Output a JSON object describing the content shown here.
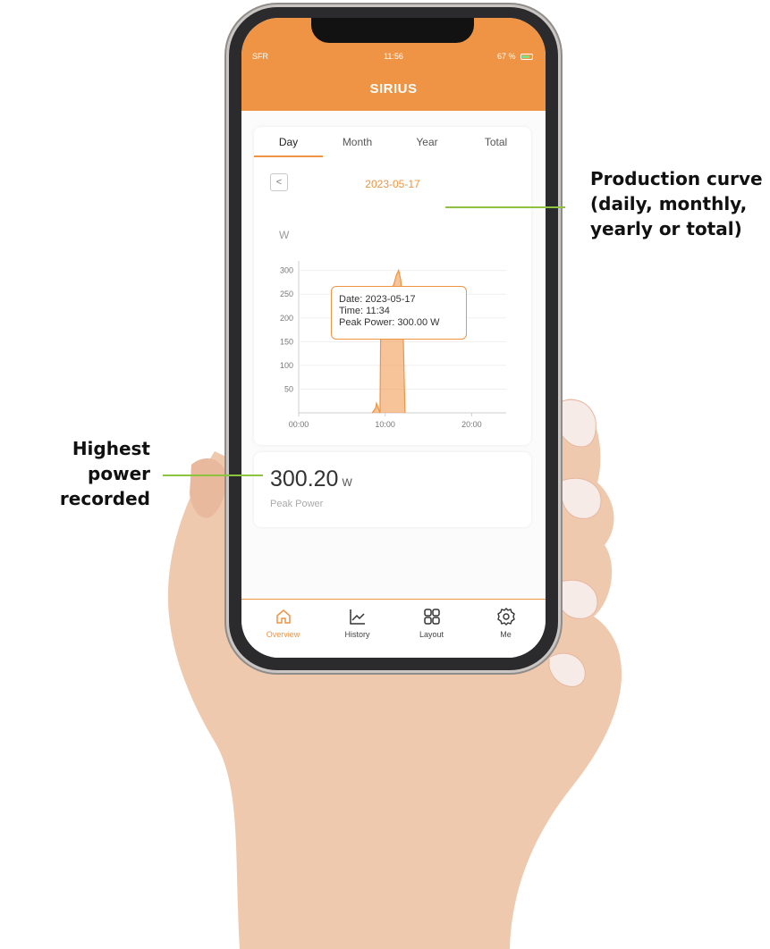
{
  "status_bar": {
    "carrier": "SFR",
    "time": "11:56",
    "battery": "67 %"
  },
  "app": {
    "title": "SIRIUS"
  },
  "tabs": [
    {
      "label": "Day",
      "active": true
    },
    {
      "label": "Month",
      "active": false
    },
    {
      "label": "Year",
      "active": false
    },
    {
      "label": "Total",
      "active": false
    }
  ],
  "date": "2023-05-17",
  "unit": "W",
  "tooltip": {
    "date_line": "Date: 2023-05-17",
    "time_line": "Time: 11:34",
    "peak_line": "Peak Power: 300.00  W"
  },
  "chart_data": {
    "type": "area",
    "xlabel": "",
    "ylabel": "W",
    "x_ticks": [
      "00:00",
      "10:00",
      "20:00"
    ],
    "y_ticks": [
      50,
      100,
      150,
      200,
      250,
      300
    ],
    "ylim": [
      0,
      320
    ],
    "xlim_hours": [
      0,
      24
    ],
    "series": [
      {
        "x_hours": [
          8.5,
          8.9,
          9.0,
          9.4,
          9.5,
          10.0,
          10.2,
          10.6,
          11.0,
          11.3,
          11.57,
          11.8,
          12.0,
          12.1,
          12.3
        ],
        "values": [
          0,
          10,
          20,
          0,
          200,
          250,
          240,
          260,
          270,
          290,
          300,
          280,
          240,
          150,
          0
        ]
      }
    ],
    "grid": true,
    "color": "#ee9444"
  },
  "peak": {
    "value": "300.20",
    "unit": "W",
    "label": "Peak Power"
  },
  "nav": [
    {
      "label": "Overview",
      "icon": "home-icon",
      "active": true
    },
    {
      "label": "History",
      "icon": "chart-line-icon",
      "active": false
    },
    {
      "label": "Layout",
      "icon": "grid-icon",
      "active": false
    },
    {
      "label": "Me",
      "icon": "gear-icon",
      "active": false
    }
  ],
  "annotations": {
    "production": [
      "Production curve",
      "(daily, monthly,",
      "yearly or total)"
    ],
    "peak": [
      "Highest power",
      "recorded"
    ]
  }
}
